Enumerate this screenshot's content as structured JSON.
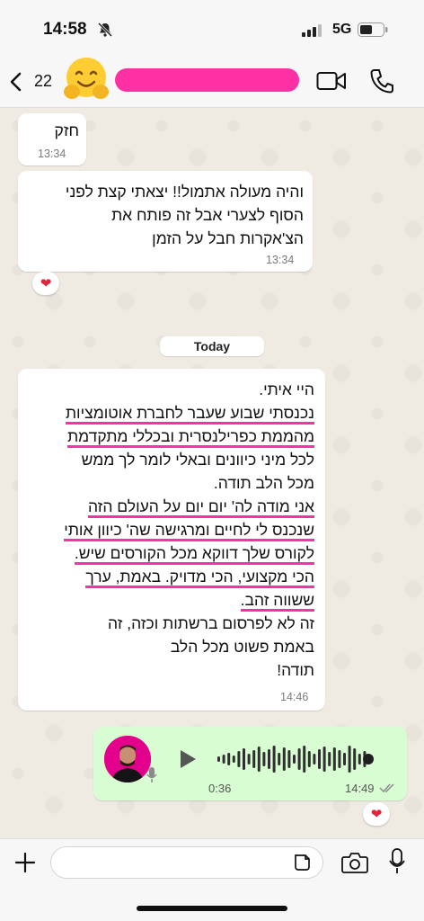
{
  "status_bar": {
    "time": "14:58",
    "network": "5G",
    "icons": [
      "bell-slash-icon",
      "signal-icon",
      "battery-icon"
    ]
  },
  "header": {
    "unread_count": "22",
    "avatar_emoji": "🤗",
    "icons": [
      "chevron-left-icon",
      "video-call-icon",
      "phone-icon"
    ],
    "name_redaction_color": "#ff2fa4"
  },
  "messages": [
    {
      "text_lines": [
        "חזק"
      ],
      "time": "13:34"
    },
    {
      "text_lines": [
        "והיה מעולה אתמול!! יצאתי קצת לפני",
        "הסוף לצערי אבל זה פותח את",
        "הצ'אקרות חבל על הזמן"
      ],
      "time": "13:34",
      "reaction": "❤"
    }
  ],
  "date_separator": "Today",
  "long_message": {
    "lines": [
      "היי איתי.",
      "נכנסתי שבוע שעבר לחברת אוטומציות",
      "מהממת כפרילנסרית ובכללי מתקדמת",
      "לכל מיני כיוונים ובאלי לומר לך ממש",
      "מכל הלב תודה.",
      "אני מודה לה' יום יום על העולם הזה",
      "שנכנס לי לחיים ומרגישה שה' כיוון אותי",
      "לקורס שלך דווקא מכל הקורסים שיש.",
      "הכי מקצועי, הכי מדויק. באמת, ערך",
      "ששווה זהב.",
      "זה לא לפרסום ברשתות וכזה, זה",
      "באמת פשוט מכל הלב",
      "תודה!"
    ],
    "time": "14:46"
  },
  "voice_message": {
    "duration": "0:36",
    "time": "14:49",
    "reaction": "❤",
    "bubble_color": "#d9fdd3"
  },
  "input": {
    "placeholder": "",
    "icons": [
      "plus-icon",
      "sticker-icon",
      "camera-icon",
      "microphone-icon"
    ]
  },
  "colors": {
    "highlight": "#ff2fa4",
    "chat_bg": "#efeae2"
  }
}
